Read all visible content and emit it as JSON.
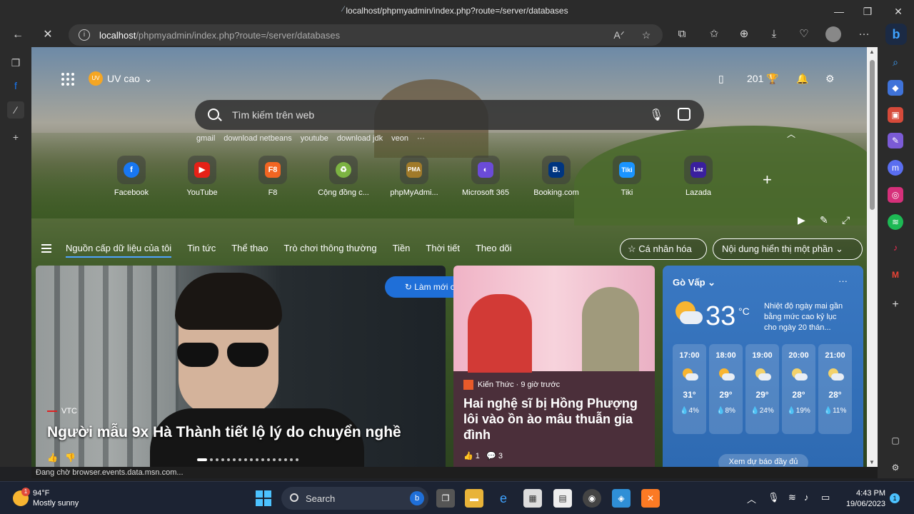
{
  "window": {
    "title": "localhost/phpmyadmin/index.php?route=/server/databases"
  },
  "address_bar": {
    "host": "localhost",
    "path": "/phpmyadmin/index.php?route=/server/databases"
  },
  "header": {
    "user_name": "UV cao",
    "avatar_text": "UV",
    "points": "201"
  },
  "search": {
    "placeholder": "Tìm kiếm trên web"
  },
  "quick_links": [
    "gmail",
    "download netbeans",
    "youtube",
    "download jdk",
    "veon",
    "···"
  ],
  "tiles": [
    {
      "label": "Facebook",
      "glyph": "f",
      "color": "#1877f2"
    },
    {
      "label": "YouTube",
      "glyph": "▶",
      "color": "#e62117"
    },
    {
      "label": "F8",
      "glyph": "F8",
      "color": "#f26522"
    },
    {
      "label": "Cộng đồng c...",
      "glyph": "♻",
      "color": "#7cb342"
    },
    {
      "label": "phpMyAdmi...",
      "glyph": "PMA",
      "color": "#a07a2a"
    },
    {
      "label": "Microsoft 365",
      "glyph": "◐",
      "color": "#6b4bd8"
    },
    {
      "label": "Booking.com",
      "glyph": "B.",
      "color": "#003580"
    },
    {
      "label": "Tiki",
      "glyph": "Tiki",
      "color": "#1a94ff"
    },
    {
      "label": "Lazada",
      "glyph": "Laz",
      "color": "#3a1f9e"
    }
  ],
  "feed_tabs": [
    "Nguồn cấp dữ liệu của tôi",
    "Tin tức",
    "Thể thao",
    "Trò chơi thông thường",
    "Tiền",
    "Thời tiết",
    "Theo dõi"
  ],
  "feed_buttons": {
    "personalize": "Cá nhân hóa",
    "content_visible": "Nội dung hiển thị một phần"
  },
  "refresh_button": "Làm mới câu chuyện",
  "main_story": {
    "source": "VTC",
    "headline": "Người mẫu 9x Hà Thành tiết lộ lý do chuyển nghề"
  },
  "side_story": {
    "meta": "Kiến Thức · 9 giờ trước",
    "headline": "Hai nghệ sĩ bị Hồng Phượng lôi vào ồn ào mâu thuẫn gia đình",
    "likes": "1",
    "comments": "3"
  },
  "weather": {
    "location": "Gò Vấp",
    "temperature": "33",
    "unit": "°C",
    "note": "Nhiệt độ ngày mai gần bằng mức cao kỷ lục cho ngày 20 thán...",
    "forecast_button": "Xem dự báo đầy đủ",
    "hourly": [
      {
        "time": "17:00",
        "temp": "31°",
        "precip": "💧4%"
      },
      {
        "time": "18:00",
        "temp": "29°",
        "precip": "💧8%"
      },
      {
        "time": "19:00",
        "temp": "29°",
        "precip": "💧24%"
      },
      {
        "time": "20:00",
        "temp": "28°",
        "precip": "💧19%"
      },
      {
        "time": "21:00",
        "temp": "28°",
        "precip": "💧11%"
      }
    ]
  },
  "status_bar": "Đang chờ browser.events.data.msn.com...",
  "taskbar": {
    "weather_temp": "94°F",
    "weather_desc": "Mostly sunny",
    "weather_badge": "1",
    "search_label": "Search",
    "time": "4:43 PM",
    "date": "19/06/2023",
    "notification_count": "1"
  }
}
